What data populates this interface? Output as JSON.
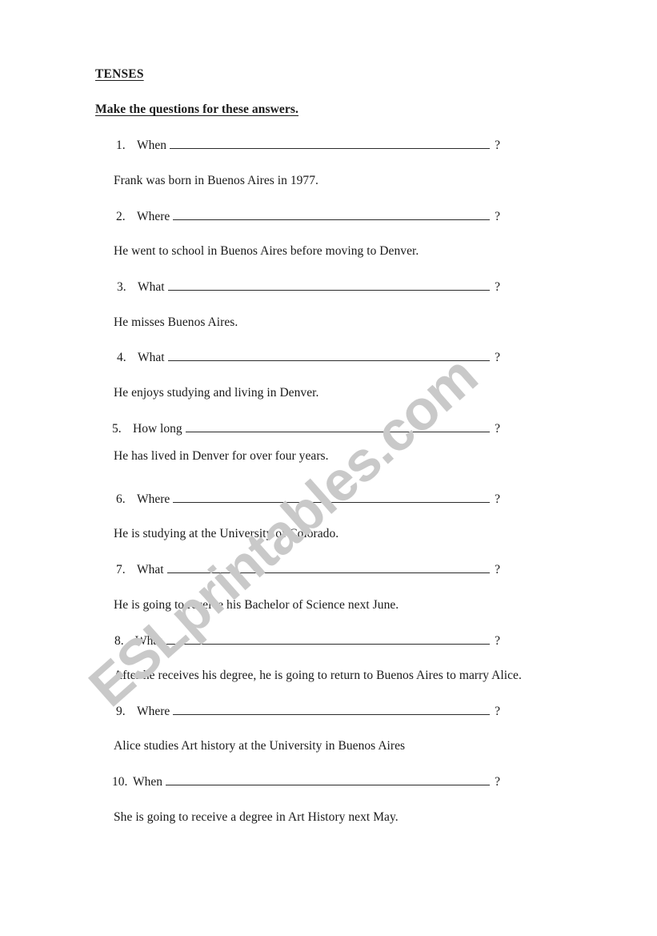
{
  "document": {
    "title": "TENSES",
    "instruction": "Make the questions for these answers.",
    "watermark": "ESLprintables.com",
    "watermark_color": "#c9c9c9",
    "text_color": "#1a1a1a",
    "page_background": "#ffffff"
  },
  "exercise": {
    "question_mark": "?",
    "items": [
      {
        "number": "1.",
        "question_word": "When",
        "answer": "Frank was born in Buenos Aires in 1977."
      },
      {
        "number": "2.",
        "question_word": "Where",
        "answer": "He went to school in Buenos Aires before moving to Denver."
      },
      {
        "number": "3.",
        "question_word": "What",
        "answer": "He misses Buenos Aires."
      },
      {
        "number": "4.",
        "question_word": "What",
        "answer": "He enjoys studying and living in Denver."
      },
      {
        "number": "5.",
        "question_word": "How long",
        "answer": "He has lived in Denver for over four years."
      },
      {
        "number": "6.",
        "question_word": "Where",
        "answer": "He is studying at the University of Colorado."
      },
      {
        "number": "7.",
        "question_word": "What",
        "answer": "He is going to receive his Bachelor of Science next June."
      },
      {
        "number": "8.",
        "question_word": "What",
        "answer": "After he receives his degree, he is going to return to Buenos Aires to marry Alice."
      },
      {
        "number": "9.",
        "question_word": "Where",
        "answer": "Alice studies Art history at the University in Buenos Aires"
      },
      {
        "number": "10.",
        "question_word": "When",
        "answer": "She is going to receive a degree in Art History next May."
      }
    ]
  }
}
